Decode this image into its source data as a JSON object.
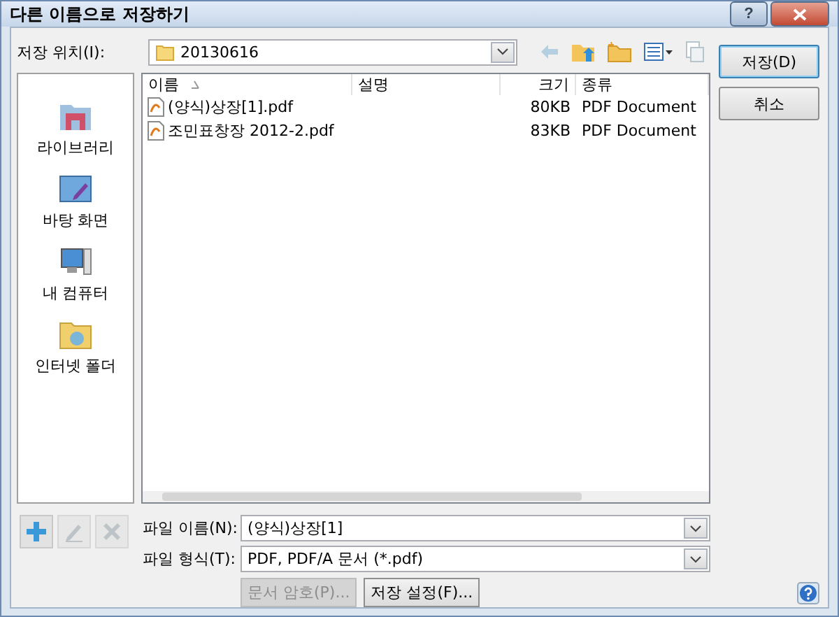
{
  "window": {
    "title": "다른 이름으로 저장하기",
    "help_glyph": "?"
  },
  "location": {
    "label": "저장 위치(I):",
    "value": "20130616"
  },
  "places": [
    {
      "kind": "library",
      "label": "라이브러리"
    },
    {
      "kind": "desktop",
      "label": "바탕 화면"
    },
    {
      "kind": "computer",
      "label": "내 컴퓨터"
    },
    {
      "kind": "internet",
      "label": "인터넷 폴더"
    }
  ],
  "table": {
    "columns": [
      "이름",
      "설명",
      "크기",
      "종류"
    ],
    "rows": [
      {
        "name": "(양식)상장[1].pdf",
        "description": "",
        "size": "80KB",
        "type": "PDF Document",
        "selected": false
      },
      {
        "name": "조민표창장 2012-2.pdf",
        "description": "",
        "size": "83KB",
        "type": "PDF Document",
        "selected": false
      }
    ]
  },
  "place_actions": [
    {
      "kind": "add",
      "disabled": false
    },
    {
      "kind": "edit",
      "disabled": true
    },
    {
      "kind": "delete",
      "disabled": true
    }
  ],
  "file_name": {
    "label": "파일 이름(N):",
    "value": "(양식)상장[1]"
  },
  "file_type": {
    "label": "파일 형식(T):",
    "value": "PDF, PDF/A 문서 (*.pdf)"
  },
  "buttons": [
    {
      "label": "문서 암호(P)...",
      "disabled": true
    },
    {
      "label": "저장 설정(F)...",
      "disabled": false
    }
  ],
  "side_buttons": [
    {
      "label": "저장(D)",
      "default": true
    },
    {
      "label": "취소",
      "default": false
    }
  ]
}
